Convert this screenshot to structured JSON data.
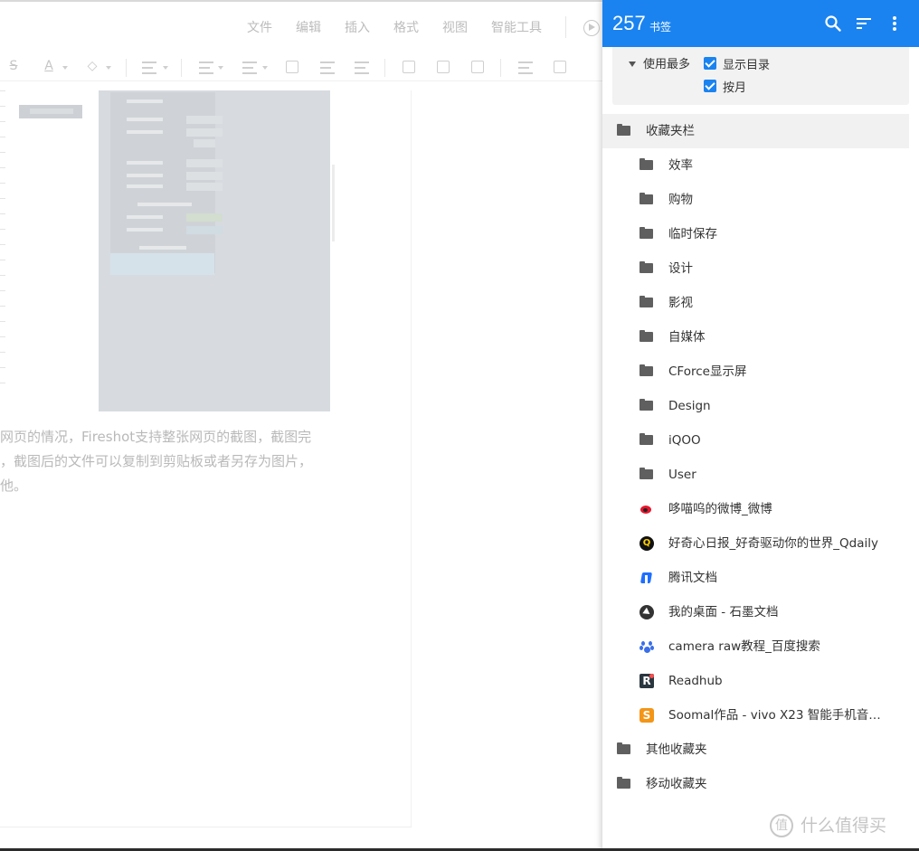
{
  "editor": {
    "menu": [
      "文件",
      "编辑",
      "插入",
      "格式",
      "视图",
      "智能工具"
    ],
    "text_lines": [
      "网页的情况，Fireshot支持整张网页的截图，截图完",
      "，截图后的文件可以复制到剪贴板或者另存为图片，",
      "他。"
    ]
  },
  "bookmarks_popup": {
    "count": "257",
    "count_unit": "书签",
    "toolbar_icons": [
      "search-icon",
      "sort-icon",
      "more-vert-icon"
    ],
    "filter": {
      "group_label": "使用最多",
      "options": [
        {
          "label": "显示目录",
          "checked": true
        },
        {
          "label": "按月",
          "checked": true
        }
      ]
    },
    "items": [
      {
        "label": "收藏夹栏",
        "type": "folder",
        "level": 0,
        "selected": true
      },
      {
        "label": "效率",
        "type": "folder",
        "level": 1
      },
      {
        "label": "购物",
        "type": "folder",
        "level": 1
      },
      {
        "label": "临时保存",
        "type": "folder",
        "level": 1
      },
      {
        "label": "设计",
        "type": "folder",
        "level": 1
      },
      {
        "label": "影视",
        "type": "folder",
        "level": 1
      },
      {
        "label": "自媒体",
        "type": "folder",
        "level": 1
      },
      {
        "label": "CForce显示屏",
        "type": "folder",
        "level": 1
      },
      {
        "label": "Design",
        "type": "folder",
        "level": 1
      },
      {
        "label": "iQOO",
        "type": "folder",
        "level": 1
      },
      {
        "label": "User",
        "type": "folder",
        "level": 1
      },
      {
        "label": "哆喵呜的微博_微博",
        "type": "link",
        "level": 1,
        "icon": "weibo-icon"
      },
      {
        "label": "好奇心日报_好奇驱动你的世界_Qdaily",
        "type": "link",
        "level": 1,
        "icon": "qdaily-icon"
      },
      {
        "label": "腾讯文档",
        "type": "link",
        "level": 1,
        "icon": "tencent-docs-icon"
      },
      {
        "label": "我的桌面 - 石墨文档",
        "type": "link",
        "level": 1,
        "icon": "shimo-icon"
      },
      {
        "label": "camera raw教程_百度搜索",
        "type": "link",
        "level": 1,
        "icon": "baidu-icon"
      },
      {
        "label": "Readhub",
        "type": "link",
        "level": 1,
        "icon": "readhub-icon"
      },
      {
        "label": "Soomal作品 - vivo X23 智能手机音质...",
        "type": "link",
        "level": 1,
        "icon": "soomal-icon"
      },
      {
        "label": "其他收藏夹",
        "type": "folder",
        "level": 0
      },
      {
        "label": "移动收藏夹",
        "type": "folder",
        "level": 0
      }
    ]
  },
  "watermark": {
    "icon_glyph": "值",
    "text": "什么值得买"
  },
  "colors": {
    "accent": "#1a83f0",
    "folder": "#5f5f5f",
    "selected_row": "#f1f1f1"
  }
}
